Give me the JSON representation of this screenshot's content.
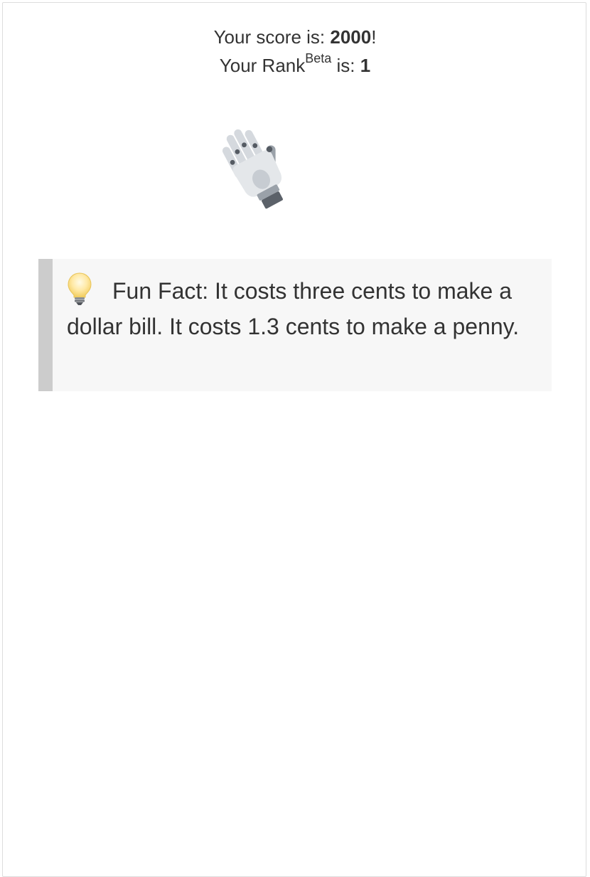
{
  "score": {
    "prefix": "Your score is: ",
    "value": "2000",
    "suffix": "!"
  },
  "rank": {
    "prefix": "Your Rank",
    "superscript": "Beta",
    "middle": " is: ",
    "value": "1"
  },
  "illustration": {
    "icon": "mechanical-arm-waving-hand-icon"
  },
  "fun_fact": {
    "icon": "light-bulb-icon",
    "text": "Fun Fact: It costs three cents to make a dollar bill. It costs 1.3 cents to make a penny."
  },
  "colors": {
    "fact_background": "#f7f7f7",
    "fact_border": "#cccccc",
    "text": "#333333"
  }
}
